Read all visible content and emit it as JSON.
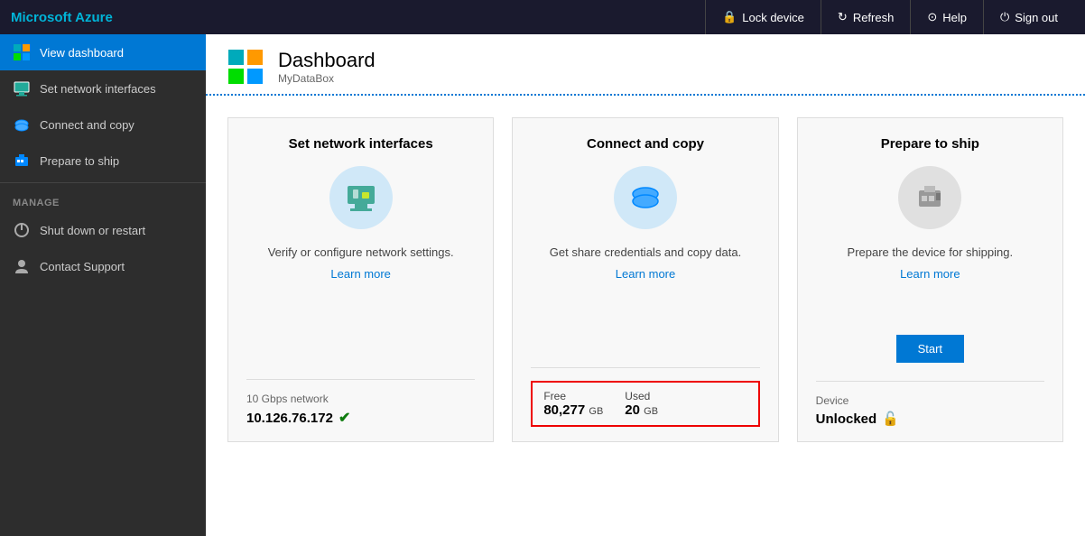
{
  "brand": "Microsoft Azure",
  "topbar": {
    "lock_label": "Lock device",
    "refresh_label": "Refresh",
    "help_label": "Help",
    "signout_label": "Sign out"
  },
  "sidebar": {
    "items": [
      {
        "id": "view-dashboard",
        "label": "View dashboard",
        "active": true,
        "icon": "grid-icon"
      },
      {
        "id": "set-network",
        "label": "Set network interfaces",
        "active": false,
        "icon": "network-icon"
      },
      {
        "id": "connect-copy",
        "label": "Connect and copy",
        "active": false,
        "icon": "copy-icon"
      },
      {
        "id": "prepare-ship",
        "label": "Prepare to ship",
        "active": false,
        "icon": "ship-icon"
      }
    ],
    "manage_label": "MANAGE",
    "manage_items": [
      {
        "id": "shutdown",
        "label": "Shut down or restart",
        "icon": "power-icon"
      },
      {
        "id": "support",
        "label": "Contact Support",
        "icon": "support-icon"
      }
    ]
  },
  "page": {
    "title": "Dashboard",
    "subtitle": "MyDataBox"
  },
  "cards": [
    {
      "id": "network",
      "title": "Set network interfaces",
      "description": "Verify or configure network settings.",
      "learn_more": "Learn more",
      "footer_label": "10 Gbps network",
      "footer_value": "10.126.76.172",
      "footer_has_check": true
    },
    {
      "id": "copy",
      "title": "Connect and copy",
      "description": "Get share credentials and copy data.",
      "learn_more": "Learn more",
      "footer_highlighted": true,
      "free_label": "Free",
      "free_value": "80,277",
      "free_unit": "GB",
      "used_label": "Used",
      "used_value": "20",
      "used_unit": "GB"
    },
    {
      "id": "ship",
      "title": "Prepare to ship",
      "description": "Prepare the device for shipping.",
      "learn_more": "Learn more",
      "start_label": "Start",
      "footer_label": "Device",
      "footer_value": "Unlocked",
      "footer_has_unlock": true
    }
  ]
}
